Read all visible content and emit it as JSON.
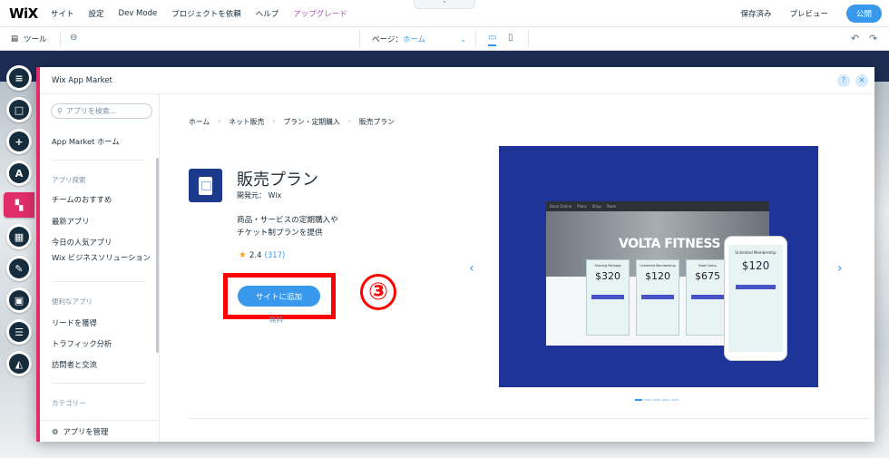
{
  "topbar": {
    "logo": "WiX",
    "menu": [
      "サイト",
      "設定",
      "Dev Mode",
      "プロジェクトを依頼",
      "ヘルプ",
      "アップグレード"
    ],
    "saved": "保存済み",
    "preview": "プレビュー",
    "publish": "公開",
    "collapse_icon": "chevron-up"
  },
  "toolbar": {
    "tools_label": "ツール",
    "page_label": "ページ：",
    "page_value": "ホーム"
  },
  "rail": [
    "pages-icon",
    "background-icon",
    "add-icon",
    "theme-icon",
    "app-market-icon",
    "media-icon",
    "blog-icon",
    "bookings-icon",
    "table-icon",
    "store-icon"
  ],
  "modal": {
    "title": "Wix App Market",
    "search_placeholder": "アプリを検索...",
    "home": "App Market ホーム",
    "section_explore": "アプリ探索",
    "explore": [
      "チームのおすすめ",
      "最新アプリ",
      "今日の人気アプリ",
      "Wix ビジネスソリューション"
    ],
    "section_useful": "便利なアプリ",
    "useful": [
      "リードを獲得",
      "トラフィック分析",
      "訪問者と交流"
    ],
    "section_category": "カテゴリー",
    "manage": "アプリを管理"
  },
  "app": {
    "breadcrumb": [
      "ホーム",
      "ネット販売",
      "プラン・定期購入",
      "販売プラン"
    ],
    "name": "販売プラン",
    "developer": "開発元： Wix",
    "desc_line1": "商品・サービスの定期購入や",
    "desc_line2": "チケット制プランを提供",
    "rating": "2.4",
    "reviews": "(317)",
    "add_button": "サイトに追加",
    "price": "無料",
    "step_marker": "③"
  },
  "screenshot": {
    "brand": "VOLTA FITNESS",
    "nav_items": [
      "Book Online",
      "Plans",
      "Shop",
      "Team"
    ],
    "plans": [
      {
        "name": "Training Package",
        "price": "$320"
      },
      {
        "name": "Unlimited Membership",
        "price": "$120"
      },
      {
        "name": "Boot Camp",
        "price": "$675"
      }
    ],
    "phone_plan": {
      "name": "Unlimited Membership",
      "price": "$120"
    },
    "slide_count": 5,
    "active_slide": 0
  },
  "colors": {
    "accent": "#3899ec",
    "rail_active": "#e12e6a",
    "highlight": "#ff0000",
    "hero_bg": "#1f3498"
  }
}
